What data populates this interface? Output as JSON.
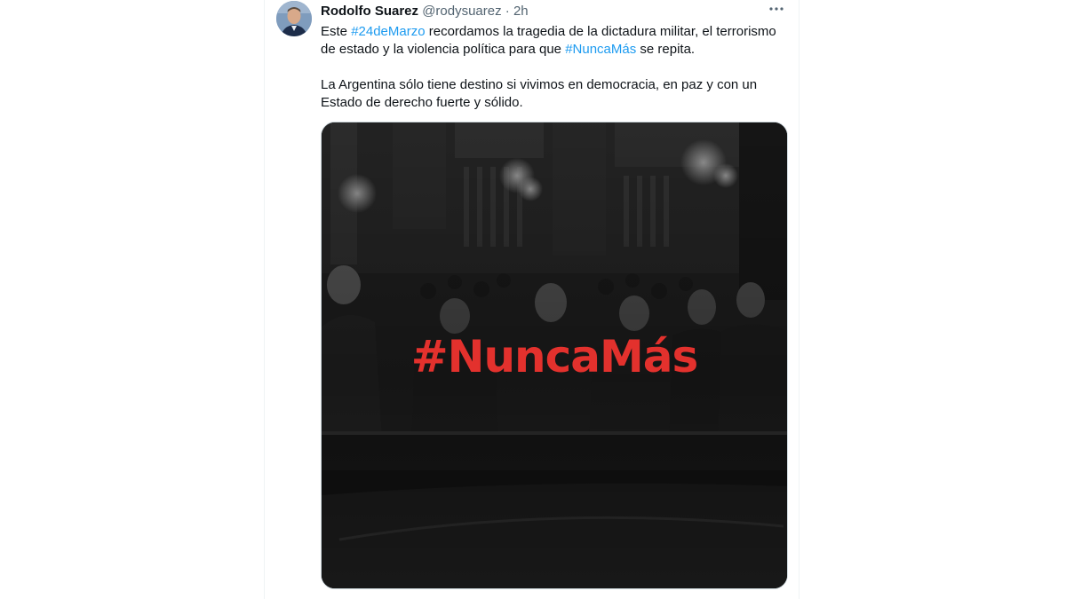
{
  "tweet": {
    "author": {
      "display_name": "Rodolfo Suarez",
      "handle": "@rodysuarez",
      "separator": "·",
      "time": "2h"
    },
    "body": {
      "p1_before": "Este ",
      "hashtag1": "#24deMarzo",
      "p1_middle": " recordamos la tragedia de la dictadura militar, el terrorismo de estado y la violencia política para que ",
      "hashtag2": "#NuncaMás",
      "p1_after": " se repita.",
      "p2": "La Argentina sólo tiene destino si vivimos en democracia, en paz y con un Estado de derecho fuerte y sólido."
    },
    "media": {
      "overlay_text": "#NuncaMás"
    },
    "icons": {
      "more": "more-horizontal-icon"
    },
    "colors": {
      "hashtag": "#1d9bf0",
      "overlay_text": "#e3312d",
      "secondary_text": "#536471"
    }
  }
}
